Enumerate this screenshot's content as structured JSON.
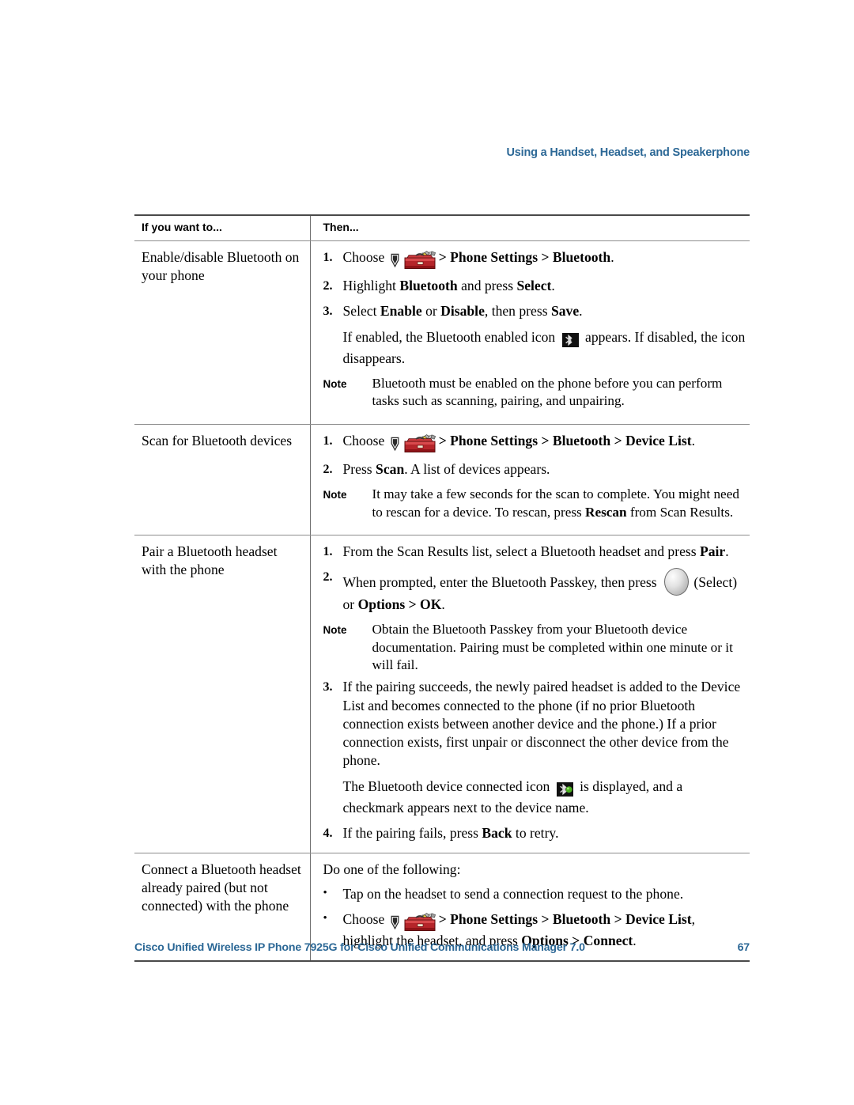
{
  "header": {
    "running_head": "Using a Handset, Headset, and Speakerphone"
  },
  "table": {
    "columns": [
      {
        "label": "If you want to..."
      },
      {
        "label": "Then..."
      }
    ],
    "rows": [
      {
        "task": "Enable/disable Bluetooth on your phone",
        "steps": [
          {
            "num": "1.",
            "type": "step",
            "segments": [
              {
                "t": "text",
                "v": "Choose "
              },
              {
                "t": "icon",
                "v": "nav-key-icon"
              },
              {
                "t": "icon",
                "v": "settings-toolbox-icon"
              },
              {
                "t": "bold",
                "v": "> Phone Settings > Bluetooth"
              },
              {
                "t": "text",
                "v": "."
              }
            ]
          },
          {
            "num": "2.",
            "type": "step",
            "segments": [
              {
                "t": "text",
                "v": "Highlight "
              },
              {
                "t": "bold",
                "v": "Bluetooth"
              },
              {
                "t": "text",
                "v": " and press "
              },
              {
                "t": "bold",
                "v": "Select"
              },
              {
                "t": "text",
                "v": "."
              }
            ]
          },
          {
            "num": "3.",
            "type": "step",
            "segments": [
              {
                "t": "text",
                "v": "Select "
              },
              {
                "t": "bold",
                "v": "Enable"
              },
              {
                "t": "text",
                "v": " or "
              },
              {
                "t": "bold",
                "v": "Disable"
              },
              {
                "t": "text",
                "v": ", then press "
              },
              {
                "t": "bold",
                "v": "Save"
              },
              {
                "t": "text",
                "v": "."
              }
            ]
          },
          {
            "num": "",
            "type": "cont",
            "segments": [
              {
                "t": "text",
                "v": "If enabled, the Bluetooth enabled icon "
              },
              {
                "t": "icon",
                "v": "bluetooth-enabled-icon"
              },
              {
                "t": "text",
                "v": " appears. If disabled, the icon disappears."
              }
            ]
          },
          {
            "type": "note",
            "label": "Note",
            "segments": [
              {
                "t": "text",
                "v": "Bluetooth must be enabled on the phone before you can perform tasks such as scanning, pairing, and unpairing."
              }
            ]
          }
        ]
      },
      {
        "task": "Scan for Bluetooth devices",
        "steps": [
          {
            "num": "1.",
            "type": "step",
            "segments": [
              {
                "t": "text",
                "v": "Choose "
              },
              {
                "t": "icon",
                "v": "nav-key-icon"
              },
              {
                "t": "icon",
                "v": "settings-toolbox-icon"
              },
              {
                "t": "bold",
                "v": "> Phone Settings > Bluetooth > Device List"
              },
              {
                "t": "text",
                "v": "."
              }
            ]
          },
          {
            "num": "2.",
            "type": "step",
            "segments": [
              {
                "t": "text",
                "v": "Press "
              },
              {
                "t": "bold",
                "v": "Scan"
              },
              {
                "t": "text",
                "v": ". A list of devices appears."
              }
            ]
          },
          {
            "type": "note",
            "label": "Note",
            "segments": [
              {
                "t": "text",
                "v": "It may take a few seconds for the scan to complete. You might need to rescan for a device. To rescan, press "
              },
              {
                "t": "bold",
                "v": "Rescan"
              },
              {
                "t": "text",
                "v": " from Scan Results."
              }
            ]
          }
        ]
      },
      {
        "task": "Pair a Bluetooth headset with the phone",
        "steps": [
          {
            "num": "1.",
            "type": "step",
            "segments": [
              {
                "t": "text",
                "v": "From the Scan Results list, select a Bluetooth headset and press "
              },
              {
                "t": "bold",
                "v": "Pair"
              },
              {
                "t": "text",
                "v": "."
              }
            ]
          },
          {
            "num": "2.",
            "type": "step",
            "segments": [
              {
                "t": "text",
                "v": "When prompted, enter the Bluetooth Passkey, then press "
              },
              {
                "t": "icon",
                "v": "select-key-icon"
              },
              {
                "t": "text",
                "v": " (Select) or "
              },
              {
                "t": "bold",
                "v": "Options > OK"
              },
              {
                "t": "text",
                "v": "."
              }
            ]
          },
          {
            "type": "note",
            "label": "Note",
            "segments": [
              {
                "t": "text",
                "v": "Obtain the Bluetooth Passkey from your Bluetooth device documentation. Pairing must be completed within one minute or it will fail."
              }
            ]
          },
          {
            "num": "3.",
            "type": "step",
            "segments": [
              {
                "t": "text",
                "v": "If the pairing succeeds, the newly paired headset is added to the Device List and becomes connected to the phone (if no prior Bluetooth connection exists between another device and the phone.) If a prior connection exists, first unpair or disconnect the other device from the phone."
              }
            ]
          },
          {
            "num": "",
            "type": "cont",
            "segments": [
              {
                "t": "text",
                "v": "The Bluetooth device connected icon "
              },
              {
                "t": "icon",
                "v": "bluetooth-connected-icon"
              },
              {
                "t": "text",
                "v": " is displayed, and a checkmark appears next to the device name."
              }
            ]
          },
          {
            "num": "4.",
            "type": "step",
            "segments": [
              {
                "t": "text",
                "v": "If the pairing fails, press "
              },
              {
                "t": "bold",
                "v": "Back"
              },
              {
                "t": "text",
                "v": " to retry."
              }
            ]
          }
        ]
      },
      {
        "task": "Connect a Bluetooth headset already paired (but not connected) with the phone",
        "lead": "Do one of the following:",
        "steps": [
          {
            "type": "bullet",
            "mark": "•",
            "segments": [
              {
                "t": "text",
                "v": "Tap on the headset to send a connection request to the phone."
              }
            ]
          },
          {
            "type": "bullet",
            "mark": "•",
            "segments": [
              {
                "t": "text",
                "v": "Choose "
              },
              {
                "t": "icon",
                "v": "nav-key-icon"
              },
              {
                "t": "icon",
                "v": "settings-toolbox-icon"
              },
              {
                "t": "bold",
                "v": "> Phone Settings > Bluetooth > Device List"
              },
              {
                "t": "text",
                "v": ", highlight the headset, and press "
              },
              {
                "t": "bold",
                "v": "Options > Connect"
              },
              {
                "t": "text",
                "v": "."
              }
            ]
          }
        ]
      }
    ]
  },
  "footer": {
    "title": "Cisco Unified Wireless IP Phone 7925G for Cisco Unified Communications Manager 7.0",
    "page_number": "67"
  },
  "colors": {
    "accent_blue": "#2c6896",
    "rule_dark": "#4a4a4a",
    "rule_light": "#8d8d8d",
    "toolbox_red": "#b5252a",
    "connected_green": "#4ab020"
  }
}
